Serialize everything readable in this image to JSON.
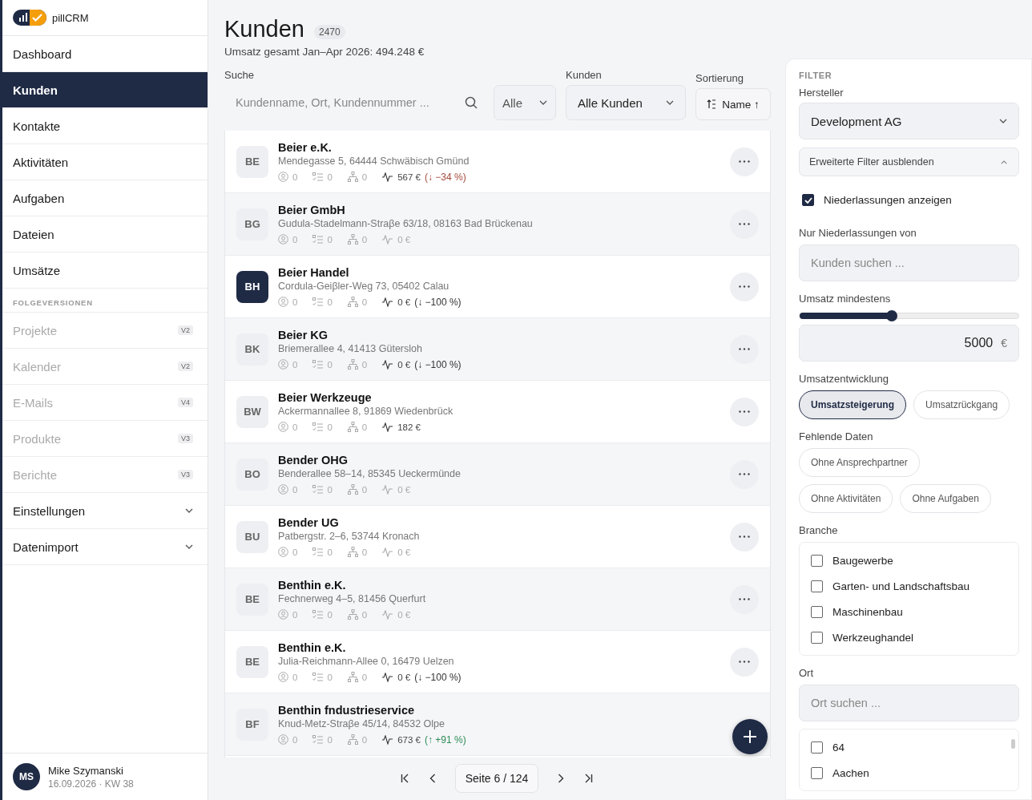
{
  "brand": {
    "name": "pillCRM"
  },
  "sidebar": {
    "items": [
      {
        "label": "Dashboard",
        "selected": false
      },
      {
        "label": "Kunden",
        "selected": true
      },
      {
        "label": "Kontakte",
        "selected": false
      },
      {
        "label": "Aktivitäten",
        "selected": false
      },
      {
        "label": "Aufgaben",
        "selected": false
      },
      {
        "label": "Dateien",
        "selected": false
      },
      {
        "label": "Umsätze",
        "selected": false
      }
    ],
    "section_title": "FOLGEVERSIONEN",
    "upcoming": [
      {
        "label": "Projekte",
        "badge": "V2"
      },
      {
        "label": "Kalender",
        "badge": "V2"
      },
      {
        "label": "E-Mails",
        "badge": "V4"
      },
      {
        "label": "Produkte",
        "badge": "V3"
      },
      {
        "label": "Berichte",
        "badge": "V3"
      }
    ],
    "groups": [
      {
        "label": "Einstellungen",
        "expanded": false
      },
      {
        "label": "Datenimport",
        "expanded": false
      }
    ],
    "user": {
      "initials": "MS",
      "name": "Mike Szymanski",
      "date": "16.09.2026 · KW 38"
    }
  },
  "header": {
    "title": "Kunden",
    "count": "2470",
    "subtitle": "Umsatz gesamt Jan–Apr 2026: 494.248 €"
  },
  "toolbar": {
    "search_label": "Suche",
    "search_placeholder": "Kundenname, Ort, Kundennummer ...",
    "scope": "Alle",
    "customers_label": "Kunden",
    "customers": "Alle Kunden",
    "sort_label": "Sortierung",
    "sort": "Name ↑"
  },
  "customers": [
    {
      "initials": "BE",
      "name": "Beier e.K.",
      "address": "Mendegasse 5, 64444 Schwäbisch Gmünd",
      "contacts": "0",
      "tasks": "0",
      "branches": "0",
      "revenue": "567 €",
      "revenue_muted": false,
      "trend": {
        "text": "(↓ −34 %)",
        "color": "#a54a3c"
      },
      "highlighted": false
    },
    {
      "initials": "BG",
      "name": "Beier GmbH",
      "address": "Gudula-Stadelmann-Straβe 63/18, 08163 Bad Brückenau",
      "contacts": "0",
      "tasks": "0",
      "branches": "0",
      "revenue": "0 €",
      "revenue_muted": true,
      "highlighted": false
    },
    {
      "initials": "BH",
      "name": "Beier Handel",
      "address": "Cordula-Geiβler-Weg 73, 05402 Calau",
      "contacts": "0",
      "tasks": "0",
      "branches": "0",
      "revenue": "0 €",
      "revenue_muted": false,
      "trend": {
        "text": "(↓ −100 %)",
        "color": "#333333"
      },
      "highlighted": true
    },
    {
      "initials": "BK",
      "name": "Beier KG",
      "address": "Briemerallee 4, 41413 Gütersloh",
      "contacts": "0",
      "tasks": "0",
      "branches": "0",
      "revenue": "0 €",
      "revenue_muted": false,
      "trend": {
        "text": "(↓ −100 %)",
        "color": "#333333"
      },
      "highlighted": false
    },
    {
      "initials": "BW",
      "name": "Beier Werkzeuge",
      "address": "Ackermannallee 8, 91869 Wiedenbrück",
      "contacts": "0",
      "tasks": "0",
      "branches": "0",
      "revenue": "182 €",
      "revenue_muted": false,
      "highlighted": false
    },
    {
      "initials": "BO",
      "name": "Bender OHG",
      "address": "Benderallee 58–14, 85345 Ueckermünde",
      "contacts": "0",
      "tasks": "0",
      "branches": "0",
      "revenue": "0 €",
      "revenue_muted": true,
      "highlighted": false
    },
    {
      "initials": "BU",
      "name": "Bender UG",
      "address": "Patbergstr. 2–6, 53744 Kronach",
      "contacts": "0",
      "tasks": "0",
      "branches": "0",
      "revenue": "0 €",
      "revenue_muted": true,
      "highlighted": false
    },
    {
      "initials": "BE",
      "name": "Benthin e.K.",
      "address": "Fechnerweg 4–5, 81456 Querfurt",
      "contacts": "0",
      "tasks": "0",
      "branches": "0",
      "revenue": "0 €",
      "revenue_muted": true,
      "highlighted": false
    },
    {
      "initials": "BE",
      "name": "Benthin e.K.",
      "address": "Julia-Reichmann-Allee 0, 16479 Uelzen",
      "contacts": "0",
      "tasks": "0",
      "branches": "0",
      "revenue": "0 €",
      "revenue_muted": false,
      "trend": {
        "text": "(↓ −100 %)",
        "color": "#333333"
      },
      "highlighted": false
    },
    {
      "initials": "BF",
      "name": "Benthin fndustrieservice",
      "address": "Knud-Metz-Straβe 45/14, 84532 Olpe",
      "contacts": "0",
      "tasks": "0",
      "branches": "0",
      "revenue": "673 €",
      "revenue_muted": false,
      "trend": {
        "text": "(↑ +91 %)",
        "color": "#2e8b57"
      },
      "highlighted": false
    }
  ],
  "pagination": {
    "page": "Seite 6 / 124"
  },
  "filter": {
    "title": "FILTER",
    "manufacturer_label": "Hersteller",
    "manufacturer": "Development AG",
    "advanced": {
      "label": "Erweiterte Filter ausblenden",
      "expanded": true
    },
    "branches_toggle": {
      "label": "Niederlassungen anzeigen",
      "checked": true
    },
    "branch_of_label": "Nur Niederlassungen von",
    "branch_of_placeholder": "Kunden suchen ...",
    "min_revenue_label": "Umsatz mindestens",
    "min_revenue": {
      "level": 0.42
    },
    "min_revenue_value": "5000",
    "currency": "€",
    "trend_label": "Umsatzentwicklung",
    "trend_chips": [
      {
        "label": "Umsatzsteigerung",
        "selected": true
      },
      {
        "label": "Umsatzrückgang",
        "selected": false
      }
    ],
    "missing_label": "Fehlende Daten",
    "missing_chips": [
      {
        "label": "Ohne Ansprechpartner",
        "selected": false
      },
      {
        "label": "Ohne Aktivitäten",
        "selected": false
      },
      {
        "label": "Ohne Aufgaben",
        "selected": false
      }
    ],
    "industry_label": "Branche",
    "industries": [
      {
        "label": "Baugewerbe",
        "checked": false
      },
      {
        "label": "Garten- und Landschaftsbau",
        "checked": false
      },
      {
        "label": "Maschinenbau",
        "checked": false
      },
      {
        "label": "Werkzeughandel",
        "checked": false
      }
    ],
    "place_label": "Ort",
    "place_placeholder": "Ort suchen ...",
    "places": [
      {
        "label": "64",
        "checked": false
      },
      {
        "label": "Aachen",
        "checked": false
      }
    ]
  }
}
